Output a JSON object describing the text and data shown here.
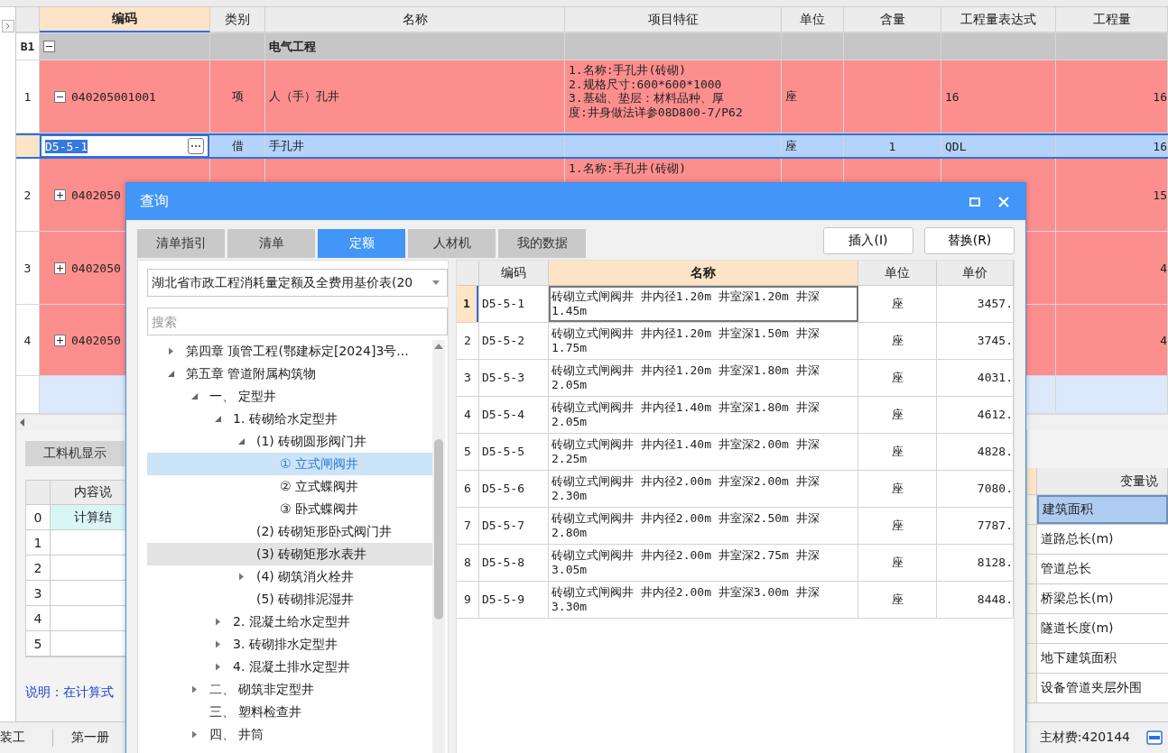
{
  "grid": {
    "columns": [
      {
        "label": "编码",
        "selected": true
      },
      {
        "label": "类别",
        "selected": false
      },
      {
        "label": "名称",
        "selected": false
      },
      {
        "label": "项目特征",
        "selected": false
      },
      {
        "label": "单位",
        "selected": false
      },
      {
        "label": "含量",
        "selected": false
      },
      {
        "label": "工程量表达式",
        "selected": false
      },
      {
        "label": "工程量",
        "selected": false
      }
    ],
    "rows": [
      {
        "kind": "group",
        "number": "B1",
        "expanded": true,
        "name": "电气工程"
      },
      {
        "kind": "item",
        "number": "1",
        "expanded": true,
        "code": "040205001001",
        "type": "项",
        "name": "人（手）孔井",
        "features": [
          "1.名称:手孔井(砖砌)",
          "2.规格尺寸:600*600*1000",
          "3.基础、垫层：材料品种、厚",
          "度:井身做法详参08D800-7/P62"
        ],
        "unit": "座",
        "expression": "16",
        "quantity": "16"
      },
      {
        "kind": "sub",
        "code": "D5-5-1",
        "type": "借",
        "name": "手孔井",
        "unit": "座",
        "content": "1",
        "expression": "QDL",
        "quantity": "16"
      },
      {
        "kind": "item",
        "number": "2",
        "expanded": false,
        "code": "0402050",
        "features": [
          "1.名称:手孔井(砖砌)"
        ],
        "quantity": "15"
      },
      {
        "kind": "item",
        "number": "3",
        "expanded": false,
        "code": "0402050",
        "quantity": "4"
      },
      {
        "kind": "item",
        "number": "4",
        "expanded": false,
        "code": "0402050",
        "quantity": "4"
      },
      {
        "kind": "blank"
      }
    ]
  },
  "bottom_panel": {
    "tab": "工料机显示",
    "table": {
      "column": "内容说",
      "rows": [
        {
          "number": "0",
          "content": "计算结"
        },
        {
          "number": "1"
        },
        {
          "number": "2"
        },
        {
          "number": "3"
        },
        {
          "number": "4"
        },
        {
          "number": "5"
        }
      ]
    },
    "note": "说明：在计算式"
  },
  "variables": {
    "header": "变量说",
    "rows": [
      {
        "label": "建筑面积",
        "selected": true
      },
      {
        "label": "道路总长(m)",
        "selected": false
      },
      {
        "label": "管道总长",
        "selected": false
      },
      {
        "label": "桥梁总长(m)",
        "selected": false
      },
      {
        "label": "隧道长度(m)",
        "selected": false
      },
      {
        "label": "地下建筑面积",
        "selected": false
      },
      {
        "label": "设备管道夹层外围",
        "selected": false
      }
    ]
  },
  "status_bar": {
    "items": [
      "装工",
      "第一册"
    ],
    "material_fee": "主材费:420144"
  },
  "dialog": {
    "title": "查询",
    "tabs": [
      {
        "label": "清单指引",
        "selected": false
      },
      {
        "label": "清单",
        "selected": false
      },
      {
        "label": "定额",
        "selected": true
      },
      {
        "label": "人材机",
        "selected": false
      },
      {
        "label": "我的数据",
        "selected": false
      }
    ],
    "buttons": [
      "插入(I)",
      "替换(R)"
    ],
    "library": "湖北省市政工程消耗量定额及全费用基价表(20",
    "search": {
      "placeholder": "搜索"
    },
    "tree": [
      {
        "label": "第四章 顶管工程(鄂建标定[2024]3号...",
        "expanded": false,
        "selected": false,
        "hovered": false
      },
      {
        "label": "第五章 管道附属构筑物",
        "expanded": true,
        "selected": false,
        "hovered": false,
        "children": [
          {
            "label": "一、 定型井",
            "expanded": true,
            "selected": false,
            "hovered": false,
            "children": [
              {
                "label": "1. 砖砌给水定型井",
                "expanded": true,
                "selected": false,
                "hovered": false,
                "children": [
                  {
                    "label": "(1) 砖砌圆形阀门井",
                    "expanded": true,
                    "selected": false,
                    "hovered": false,
                    "children": [
                      {
                        "label": "① 立式闸阀井",
                        "selected": true,
                        "hovered": false
                      },
                      {
                        "label": "② 立式蝶阀井",
                        "selected": false,
                        "hovered": false
                      },
                      {
                        "label": "③ 卧式蝶阀井",
                        "selected": false,
                        "hovered": false
                      }
                    ]
                  },
                  {
                    "label": "(2) 砖砌矩形卧式阀门井",
                    "selected": false,
                    "hovered": false
                  },
                  {
                    "label": "(3) 砖砌矩形水表井",
                    "selected": false,
                    "hovered": true
                  },
                  {
                    "label": "(4) 砌筑消火栓井",
                    "expanded": false,
                    "selected": false,
                    "hovered": false
                  },
                  {
                    "label": "(5) 砖砌排泥湿井",
                    "selected": false,
                    "hovered": false
                  }
                ]
              },
              {
                "label": "2. 混凝土给水定型井",
                "expanded": false,
                "selected": false,
                "hovered": false
              },
              {
                "label": "3. 砖砌排水定型井",
                "expanded": false,
                "selected": false,
                "hovered": false
              },
              {
                "label": "4. 混凝土排水定型井",
                "expanded": false,
                "selected": false,
                "hovered": false
              }
            ]
          },
          {
            "label": "二、 砌筑非定型井",
            "expanded": false,
            "selected": false,
            "hovered": false
          },
          {
            "label": "三、 塑料检查井",
            "selected": false,
            "hovered": false
          },
          {
            "label": "四、 井筒",
            "expanded": false,
            "selected": false,
            "hovered": false
          }
        ]
      }
    ],
    "results": {
      "columns": [
        {
          "label": "编码",
          "selected": false
        },
        {
          "label": "名称",
          "selected": true
        },
        {
          "label": "单位",
          "selected": false
        },
        {
          "label": "单价",
          "selected": false
        }
      ],
      "rows": [
        {
          "number": "1",
          "code": "D5-5-1",
          "name": "砖砌立式闸阀井 井内径1.20m 井室深1.20m 井深 1.45m",
          "unit": "座",
          "price": "3457.",
          "selected": true
        },
        {
          "number": "2",
          "code": "D5-5-2",
          "name": "砖砌立式闸阀井 井内径1.20m 井室深1.50m 井深 1.75m",
          "unit": "座",
          "price": "3745.",
          "selected": false
        },
        {
          "number": "3",
          "code": "D5-5-3",
          "name": "砖砌立式闸阀井 井内径1.20m 井室深1.80m 井深 2.05m",
          "unit": "座",
          "price": "4031.",
          "selected": false
        },
        {
          "number": "4",
          "code": "D5-5-4",
          "name": "砖砌立式闸阀井 井内径1.40m 井室深1.80m 井深 2.05m",
          "unit": "座",
          "price": "4612.",
          "selected": false
        },
        {
          "number": "5",
          "code": "D5-5-5",
          "name": "砖砌立式闸阀井 井内径1.40m 井室深2.00m 井深 2.25m",
          "unit": "座",
          "price": "4828.",
          "selected": false
        },
        {
          "number": "6",
          "code": "D5-5-6",
          "name": "砖砌立式闸阀井 井内径2.00m 井室深2.00m 井深 2.30m",
          "unit": "座",
          "price": "7080.",
          "selected": false
        },
        {
          "number": "7",
          "code": "D5-5-7",
          "name": "砖砌立式闸阀井 井内径2.00m 井室深2.50m 井深 2.80m",
          "unit": "座",
          "price": "7787.",
          "selected": false
        },
        {
          "number": "8",
          "code": "D5-5-8",
          "name": "砖砌立式闸阀井 井内径2.00m 井室深2.75m 井深 3.05m",
          "unit": "座",
          "price": "8128.",
          "selected": false
        },
        {
          "number": "9",
          "code": "D5-5-9",
          "name": "砖砌立式闸阀井 井内径2.00m 井室深3.00m 井深 3.30m",
          "unit": "座",
          "price": "8448.",
          "selected": false
        }
      ]
    }
  }
}
